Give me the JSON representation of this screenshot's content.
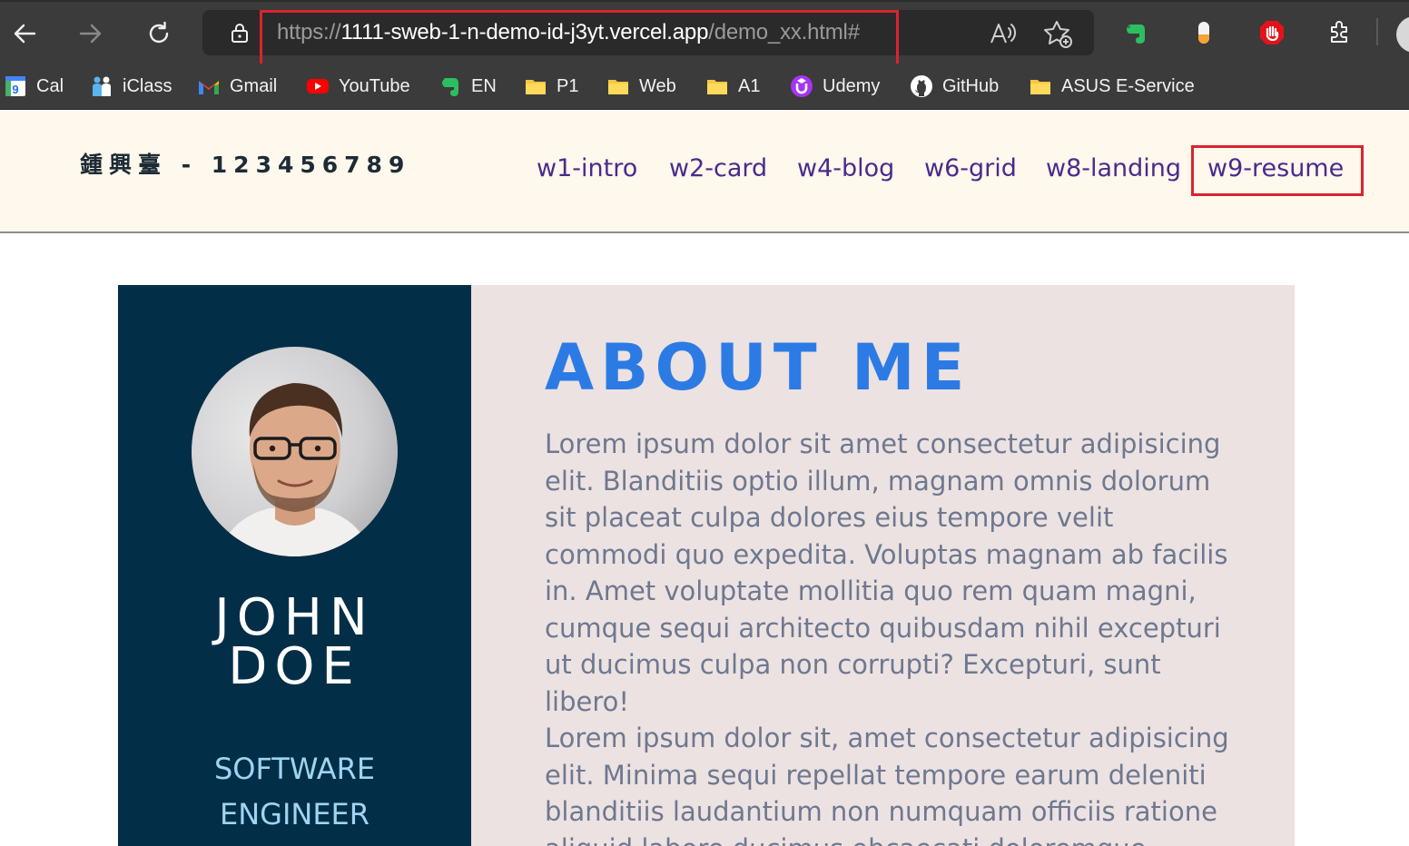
{
  "browser": {
    "url_scheme": "https://",
    "url_host": "1111-sweb-1-n-demo-id-j3yt.vercel.app",
    "url_path": "/demo_xx.html#"
  },
  "bookmarks": [
    {
      "label": "Cal",
      "icon": "calendar-icon"
    },
    {
      "label": "iClass",
      "icon": "iclass-icon"
    },
    {
      "label": "Gmail",
      "icon": "gmail-icon"
    },
    {
      "label": "YouTube",
      "icon": "youtube-icon"
    },
    {
      "label": "EN",
      "icon": "evernote-icon"
    },
    {
      "label": "P1",
      "icon": "folder-icon"
    },
    {
      "label": "Web",
      "icon": "folder-icon"
    },
    {
      "label": "A1",
      "icon": "folder-icon"
    },
    {
      "label": "Udemy",
      "icon": "udemy-icon"
    },
    {
      "label": "GitHub",
      "icon": "github-icon"
    },
    {
      "label": "ASUS E-Service",
      "icon": "folder-icon"
    }
  ],
  "header": {
    "brand": "鍾興臺 - 123456789",
    "menu": [
      "w1-intro",
      "w2-card",
      "w4-blog",
      "w6-grid",
      "w8-landing",
      "w9-resume"
    ],
    "active": "w9-resume"
  },
  "resume": {
    "first_name": "JOHN",
    "last_name": "DOE",
    "role_line1": "SOFTWARE",
    "role_line2": "ENGINEER",
    "about_title": "ABOUT ME",
    "paragraph1": "Lorem ipsum dolor sit amet consectetur adipisicing elit. Blanditiis optio illum, magnam omnis dolorum sit placeat culpa dolores eius tempore velit commodi quo expedita. Voluptas magnam ab facilis in. Amet voluptate mollitia quo rem quam magni, cumque sequi architecto quibusdam nihil excepturi ut ducimus culpa non corrupti? Excepturi, sunt libero!",
    "paragraph2": "Lorem ipsum dolor sit, amet consectetur adipisicing elit. Minima sequi repellat tempore earum deleniti blanditiis laudantium non numquam officiis ratione aliquid labore ducimus obcaecati doloremque"
  },
  "colors": {
    "sidebar": "#032e48",
    "accent": "#2c7be5",
    "role": "#9fd5f2",
    "main_bg": "#ece2e1",
    "header_bg": "#fff8ec",
    "menu_link": "#4a2b8c",
    "highlight": "#d9242e"
  }
}
